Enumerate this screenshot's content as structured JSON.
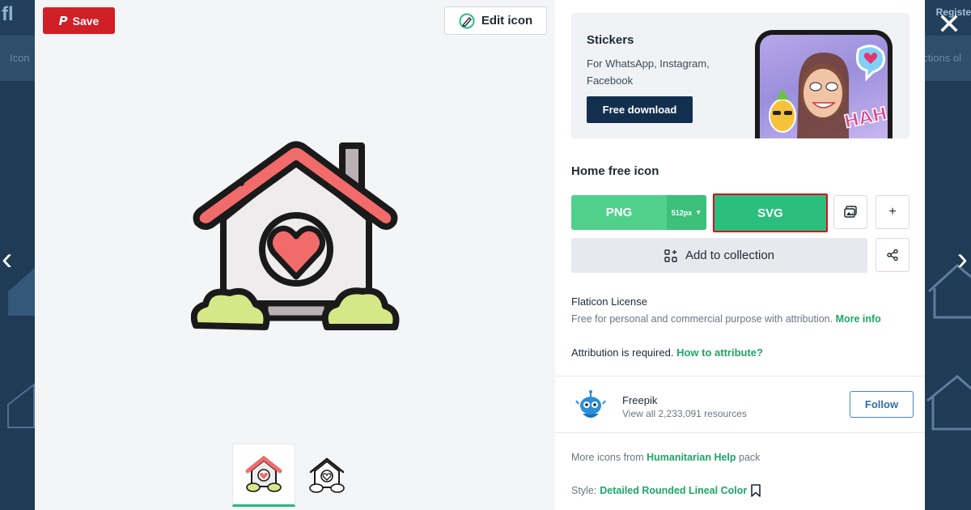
{
  "preview": {
    "save_label": "Save",
    "edit_label": "Edit icon",
    "thumbnails": [
      "Home (color)",
      "Home (outline)"
    ]
  },
  "promo": {
    "title": "Stickers",
    "description": "For WhatsApp, Instagram, Facebook",
    "button": "Free download",
    "sticker_text": "HAHA"
  },
  "download": {
    "icon_title": "Home free icon",
    "png_label": "PNG",
    "png_size": "512px",
    "svg_label": "SVG",
    "add_collection": "Add to collection"
  },
  "license": {
    "title": "Flaticon License",
    "description": "Free for personal and commercial purpose with attribution.",
    "more_info": "More info",
    "attribution": "Attribution is required.",
    "how_to": "How to attribute?"
  },
  "author": {
    "name": "Freepik",
    "resources": "View all 2,233,091 resources",
    "follow": "Follow"
  },
  "pack": {
    "prefix": "More icons from",
    "name": "Humanitarian Help",
    "suffix": "pack"
  },
  "style": {
    "prefix": "Style:",
    "name": "Detailed Rounded Lineal Color"
  },
  "background": {
    "logo": "fl",
    "register": "Registe",
    "left_text": "Icon",
    "right_text": "ctions",
    "right_text2": "ol"
  },
  "colors": {
    "accent_green": "#2bbf7e",
    "save_red": "#d01f26",
    "highlight_border": "#d8101c",
    "roof": "#f26b6b",
    "bush": "#d4e887"
  }
}
